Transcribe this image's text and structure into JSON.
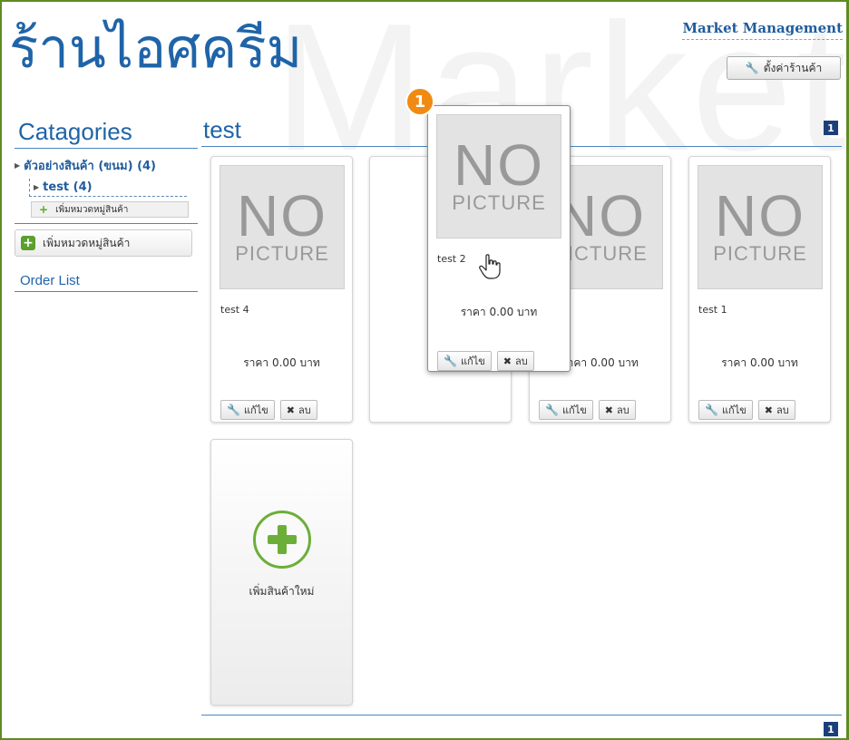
{
  "shop_name": "ร้านไอศครีม",
  "watermark": "Market",
  "market_management": "Market Management",
  "settings_button": "ตั้งค่าร้านค้า",
  "sidebar": {
    "title": "Catagories",
    "category": "ตัวอย่างสินค้า (ขนม) (4)",
    "subcategory": "test (4)",
    "add_sub": "เพิ่มหมวดหมู่สินค้า",
    "add_category": "เพิ่มหมวดหมู่สินค้า",
    "order_list": "Order List"
  },
  "main": {
    "title": "test",
    "page_top": "1",
    "page_bottom": "1"
  },
  "products": [
    {
      "name": "test 4",
      "price": "ราคา 0.00 บาท",
      "edit": "แก้ไข",
      "delete": "ลบ"
    },
    {
      "name": "",
      "price": "ราคา 0.00 บาท",
      "edit": "แก้ไข",
      "delete": "ลบ"
    },
    {
      "name": "",
      "price": "ราคา 0.00 บาท",
      "edit": "แก้ไข",
      "delete": "ลบ"
    },
    {
      "name": "test 1",
      "price": "ราคา 0.00 บาท",
      "edit": "แก้ไข",
      "delete": "ลบ"
    }
  ],
  "no_picture": {
    "no": "NO",
    "picture": "PICTURE"
  },
  "dragging": {
    "name": "test 2",
    "price": "ราคา 0.00 บาท",
    "edit": "แก้ไข",
    "delete": "ลบ"
  },
  "step_badge": "1",
  "add_product": "เพิ่มสินค้าใหม่",
  "colors": {
    "accent": "#1f64a8",
    "frame": "#5e8b22",
    "badge": "#f08a12"
  }
}
